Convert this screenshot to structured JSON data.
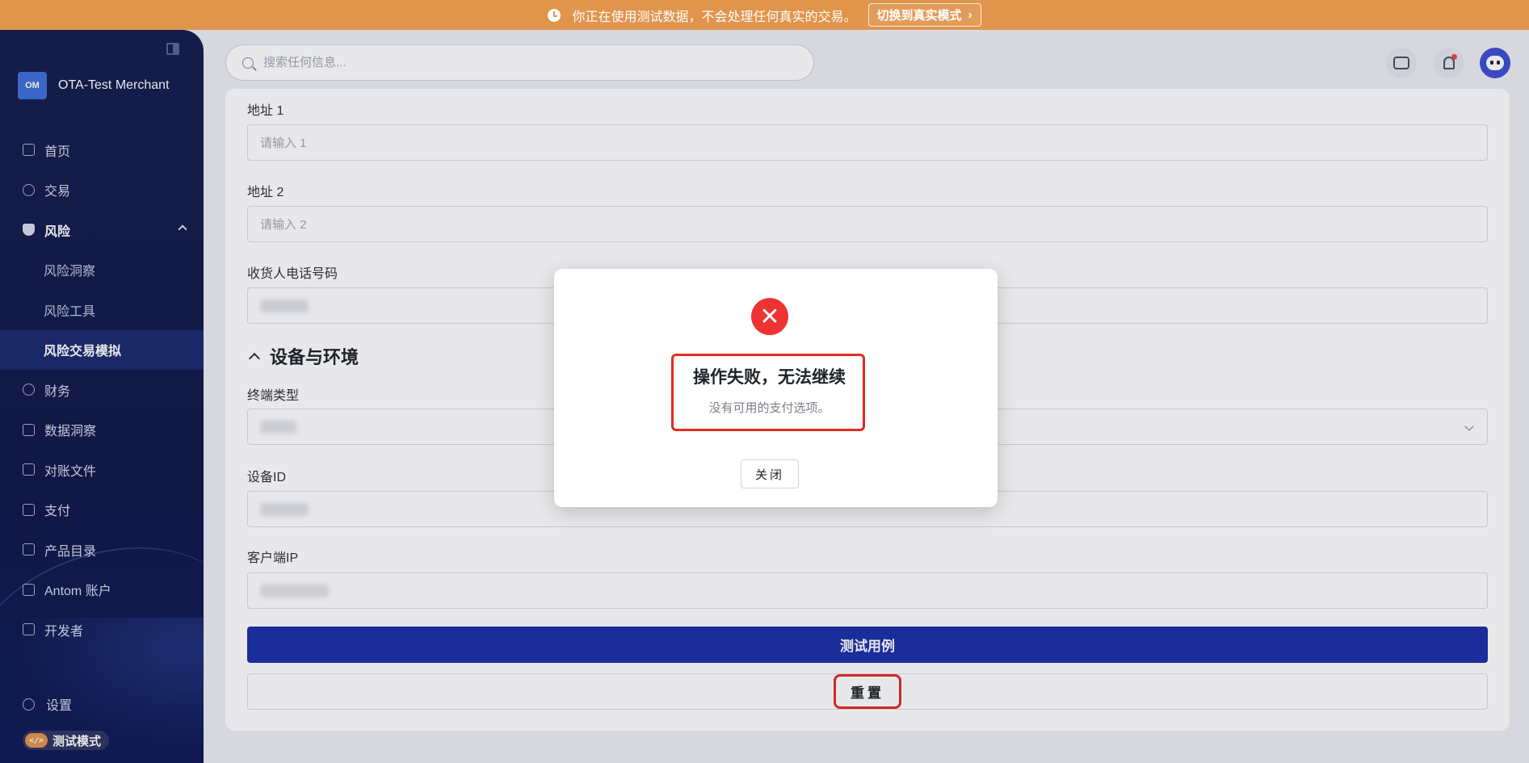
{
  "banner": {
    "message": "你正在使用测试数据，不会处理任何真实的交易。",
    "switch_label": "切换到真实模式",
    "switch_chevron": "›"
  },
  "sidebar": {
    "merchant_logo": "OM",
    "merchant_name": "OTA-Test Merchant",
    "items": [
      {
        "label": "首页",
        "icon": "home-icon"
      },
      {
        "label": "交易",
        "icon": "compass-icon"
      },
      {
        "label": "风险",
        "icon": "shield-icon",
        "expanded": true
      },
      {
        "label": "风险洞察",
        "sub": true
      },
      {
        "label": "风险工具",
        "sub": true
      },
      {
        "label": "风险交易模拟",
        "sub": true,
        "active": true
      },
      {
        "label": "财务",
        "icon": "finance-icon"
      },
      {
        "label": "数据洞察",
        "icon": "bar-chart-icon"
      },
      {
        "label": "对账文件",
        "icon": "clipboard-icon"
      },
      {
        "label": "支付",
        "icon": "wallet-icon"
      },
      {
        "label": "产品目录",
        "icon": "grid-icon"
      },
      {
        "label": "Antom 账户",
        "icon": "account-icon"
      },
      {
        "label": "开发者",
        "icon": "terminal-icon"
      }
    ],
    "settings_label": "设置",
    "test_mode_label": "测试模式",
    "test_mode_icon_text": "</>"
  },
  "header": {
    "search_placeholder": "搜索任何信息..."
  },
  "form": {
    "address1_label": "地址 1",
    "address1_placeholder": "请输入 1",
    "address2_label": "地址 2",
    "address2_placeholder": "请输入 2",
    "phone_label": "收货人电话号码",
    "section_title": "设备与环境",
    "terminal_label": "终端类型",
    "device_id_label": "设备ID",
    "client_ip_label": "客户端IP",
    "test_button": "测试用例",
    "reset_button": "重置"
  },
  "modal": {
    "title": "操作失败，无法继续",
    "description": "没有可用的支付选项。",
    "close_button": "关闭",
    "error_symbol": "✕"
  },
  "colors": {
    "banner": "#e0944c",
    "sidebar": "#141d4d",
    "primary": "#1a2fa8",
    "error": "#ee3333",
    "highlight": "#e52b20"
  }
}
